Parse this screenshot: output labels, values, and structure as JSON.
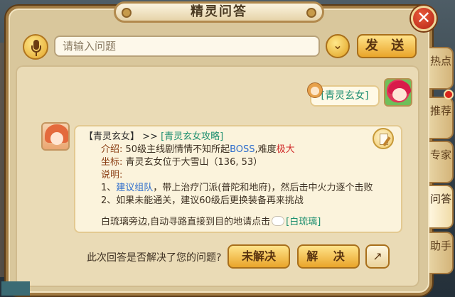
{
  "window": {
    "title": "精灵问答"
  },
  "toolbar": {
    "search_placeholder": "请输入问题",
    "send_label": "发 送"
  },
  "conversation": {
    "user_question": "[青灵玄女]",
    "answer": {
      "speaker": "【青灵玄女】",
      "arrow": ">>",
      "guide_link": "[青灵玄女攻略]",
      "intro_label": "介绍:",
      "intro_text": "50级主线剧情情不知所起",
      "intro_boss": "BOSS",
      "intro_mid": ",难度",
      "intro_difficulty": "极大",
      "coord_label": "坐标:",
      "coord_text": "青灵玄女位于大雪山（136, 53）",
      "note_label": "说明:",
      "step1_prefix": "1、",
      "step1_link": "建议组队",
      "step1_text": "，带上治疗门派(普陀和地府)，然后击中火力逐个击败",
      "step2": "2、如果未能通关，建议60级后更换装备再来挑战",
      "npc_hint": "白琉璃旁边,自动寻路直接到目的地请点击",
      "npc_link": "[白琉璃]"
    }
  },
  "feedback": {
    "question": "此次回答是否解决了您的问题?",
    "unsolved_label": "未解决",
    "solved_label": "解 决"
  },
  "side_tabs": [
    {
      "label": "热点"
    },
    {
      "label": "推荐"
    },
    {
      "label": "专家"
    },
    {
      "label": "问答"
    },
    {
      "label": "助手"
    }
  ],
  "colors": {
    "panel": "#d9c79c",
    "accent_gold": "#e9a52a",
    "link_teal": "#1d8f6f",
    "highlight_red": "#d02a2a",
    "highlight_blue": "#2c6ccc",
    "close_red": "#c23018"
  },
  "icons": [
    "microphone-icon",
    "chevron-down-icon",
    "close-icon",
    "note-pen-icon",
    "share-icon",
    "sheep-icon",
    "monkey-icon"
  ]
}
